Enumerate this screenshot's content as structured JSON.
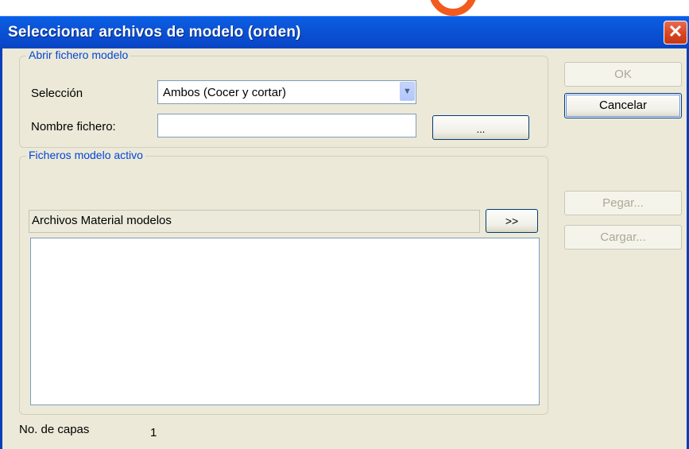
{
  "window": {
    "title": "Seleccionar archivos de modelo (orden)",
    "close_glyph": "✕"
  },
  "open_group": {
    "legend": "Abrir fichero modelo",
    "selection_label": "Selección",
    "selection_value": "Ambos (Cocer y cortar)",
    "filename_label": "Nombre fichero:",
    "filename_value": "",
    "browse_label": "..."
  },
  "active_group": {
    "legend": "Ficheros modelo activo",
    "list_header": "Archivos Material modelos",
    "expand_label": ">>",
    "items": []
  },
  "side_buttons": {
    "ok": "OK",
    "cancel": "Cancelar",
    "paste": "Pegar...",
    "load": "Cargar..."
  },
  "footer": {
    "layers_label": "No. de capas",
    "layers_value": "1"
  },
  "colors": {
    "titlebar": "#0a4cd0",
    "close": "#d6441f",
    "legend": "#0046d5",
    "background": "#ece9d8"
  }
}
